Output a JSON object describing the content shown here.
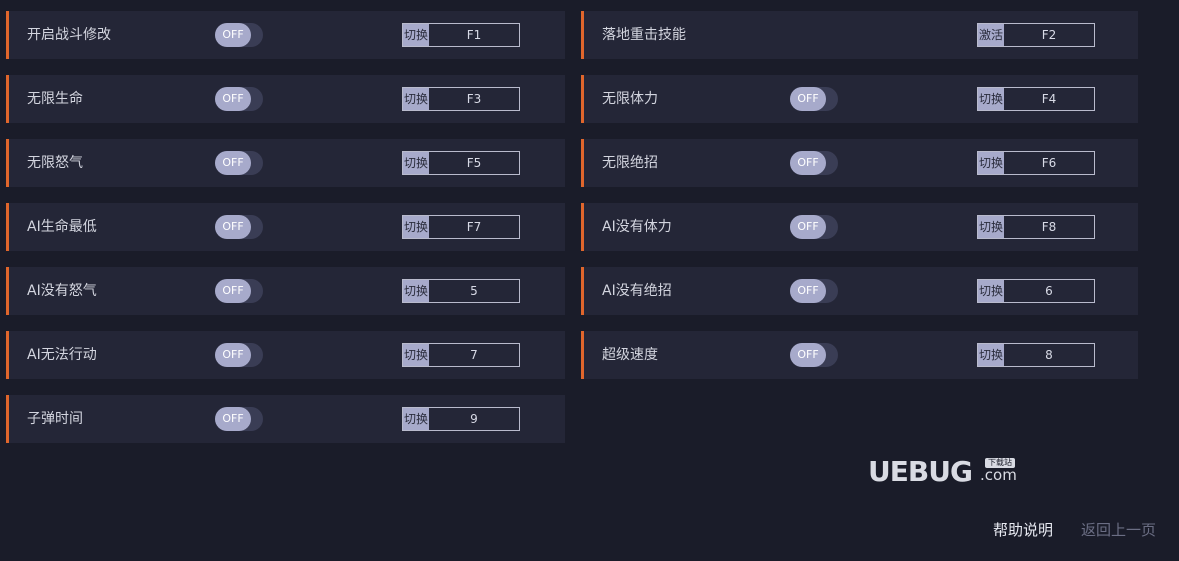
{
  "rows": [
    {
      "label": "开启战斗修改",
      "toggle": "OFF",
      "mode": "切换",
      "key": "F1"
    },
    {
      "label": "落地重击技能",
      "toggle": null,
      "mode": "激活",
      "key": "F2"
    },
    {
      "label": "无限生命",
      "toggle": "OFF",
      "mode": "切换",
      "key": "F3"
    },
    {
      "label": "无限体力",
      "toggle": "OFF",
      "mode": "切换",
      "key": "F4"
    },
    {
      "label": "无限怒气",
      "toggle": "OFF",
      "mode": "切换",
      "key": "F5"
    },
    {
      "label": "无限绝招",
      "toggle": "OFF",
      "mode": "切换",
      "key": "F6"
    },
    {
      "label": "AI生命最低",
      "toggle": "OFF",
      "mode": "切换",
      "key": "F7"
    },
    {
      "label": "AI没有体力",
      "toggle": "OFF",
      "mode": "切换",
      "key": "F8"
    },
    {
      "label": "AI没有怒气",
      "toggle": "OFF",
      "mode": "切换",
      "key": "5"
    },
    {
      "label": "AI没有绝招",
      "toggle": "OFF",
      "mode": "切换",
      "key": "6"
    },
    {
      "label": "AI无法行动",
      "toggle": "OFF",
      "mode": "切换",
      "key": "7"
    },
    {
      "label": "超级速度",
      "toggle": "OFF",
      "mode": "切换",
      "key": "8"
    },
    {
      "label": "子弹时间",
      "toggle": "OFF",
      "mode": "切换",
      "key": "9"
    }
  ],
  "logo": {
    "brand": "UEBUG",
    "dotcom": ".com",
    "tag": "下载站"
  },
  "footer": {
    "help": "帮助说明",
    "back": "返回上一页"
  },
  "colors": {
    "accent": "#e0662c",
    "background": "#1a1c29",
    "row": "#242637"
  }
}
